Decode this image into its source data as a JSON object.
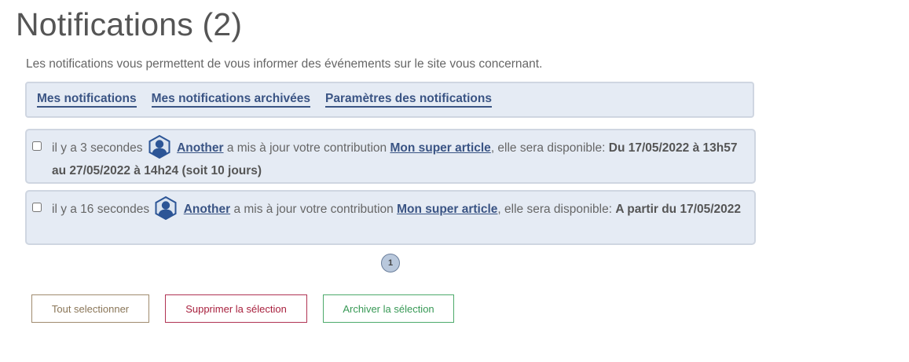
{
  "page": {
    "title": "Notifications (2)",
    "intro": "Les notifications vous permettent de vous informer des événements sur le site vous concernant."
  },
  "tabs": [
    {
      "label": "Mes notifications"
    },
    {
      "label": "Mes notifications archivées"
    },
    {
      "label": "Paramètres des notifications"
    }
  ],
  "notifications": [
    {
      "time": "il y a 3 secondes",
      "user": "Another",
      "action": "a mis à jour votre contribution",
      "article": "Mon super article",
      "suffix": ", elle sera disponible:",
      "availability": "Du 17/05/2022 à 13h57 au 27/05/2022 à 14h24 (soit 10 jours)",
      "avatar_icon": "user-avatar-icon"
    },
    {
      "time": "il y a 16 secondes",
      "user": "Another",
      "action": "a mis à jour votre contribution",
      "article": "Mon super article",
      "suffix": ", elle sera disponible:",
      "availability": "A partir du 17/05/2022",
      "avatar_icon": "user-avatar-icon"
    }
  ],
  "pagination": {
    "current_page": "1"
  },
  "buttons": {
    "select_all": "Tout selectionner",
    "delete_selection": "Supprimer la sélection",
    "archive_selection": "Archiver la sélection"
  },
  "colors": {
    "link": "#3a5484",
    "panel_bg": "#e5ebf4",
    "delete": "#a8213e",
    "archive": "#389956",
    "select": "#8a7658"
  }
}
